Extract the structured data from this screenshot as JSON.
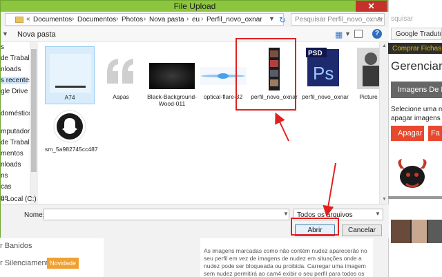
{
  "dialog": {
    "title": "File Upload",
    "close_symbol": "✕",
    "breadcrumb": {
      "prefix": "«",
      "items": [
        "Documentos",
        "Documentos",
        "Photos",
        "Nova pasta",
        "eu",
        "Perfil_novo_oxnar"
      ],
      "separator": "›"
    },
    "search_placeholder": "Pesquisar Perfil_novo_oxnar",
    "toolbar": {
      "new_folder_label": "Nova pasta"
    },
    "nav_items": [
      {
        "label": "s",
        "selected": false
      },
      {
        "label": "de Trabalho",
        "selected": false
      },
      {
        "label": "nloads",
        "selected": false
      },
      {
        "label": "s recentes",
        "selected": true
      },
      {
        "label": "gle Drive",
        "selected": false
      },
      {
        "label": "",
        "selected": false
      },
      {
        "label": "doméstico",
        "selected": false
      },
      {
        "label": "",
        "selected": false
      },
      {
        "label": "mputador",
        "selected": false
      },
      {
        "label": "de Trabalho",
        "selected": false
      },
      {
        "label": "mentos",
        "selected": false
      },
      {
        "label": "nloads",
        "selected": false
      },
      {
        "label": "ns",
        "selected": false
      },
      {
        "label": "cas",
        "selected": false
      },
      {
        "label": "os",
        "selected": false
      },
      {
        "label": "o Local (C:)",
        "selected": false
      }
    ],
    "files": [
      {
        "name": "A74",
        "icon": "a74-thumbnail",
        "selected": true
      },
      {
        "name": "Aspas",
        "icon": "quote-marks-thumbnail",
        "selected": false
      },
      {
        "name": "Black-Background-Wood-011",
        "icon": "dark-wood-thumbnail",
        "selected": false
      },
      {
        "name": "optical-flare-32",
        "icon": "blue-flare-thumbnail",
        "selected": false
      },
      {
        "name": "perfil_novo_oxnar",
        "icon": "profile-strip-thumbnail",
        "selected": false
      },
      {
        "name": "perfil_novo_oxnar",
        "icon": "photoshop-psd-icon",
        "selected": false
      },
      {
        "name": "Picture 2",
        "icon": "portrait-thumbnail",
        "selected": false
      },
      {
        "name": "sm_5a982745cc487",
        "icon": "snapchat-icon",
        "selected": false
      }
    ],
    "name_label": "Nome:",
    "name_value": "",
    "file_type_value": "Todos os arquivos",
    "open_label": "Abrir",
    "cancel_label": "Cancelar"
  },
  "background_page": {
    "search_text": "squisar",
    "google_translate": "Google Tradutor",
    "comprar_fichas": "Comprar Fichas )",
    "heading": "Gerenciar I",
    "images_bar": "Imagens De Pe",
    "select_text_1": "Selecione uma m",
    "select_text_2": "apagar imagens",
    "apagar_label": "Apagar",
    "fa_label": "Fa",
    "left_item_1": "r Banidos",
    "left_item_2": "r Silenciamento",
    "badge_new": "Novidade",
    "hidden_heading": "... imagens marcadas como não contém nudez ...",
    "body_text": "As imagens marcadas como não contém nudez aparecerão no seu perfil em vez de imagens de nudez em situações onde a nudez pode ser bloqueada ou proibida. Carregar uma imagem sem nudez permitirá ao cam4 exibir o seu perfil para todos os públicos e é recomendado."
  },
  "annotation_color": "#e0201e"
}
